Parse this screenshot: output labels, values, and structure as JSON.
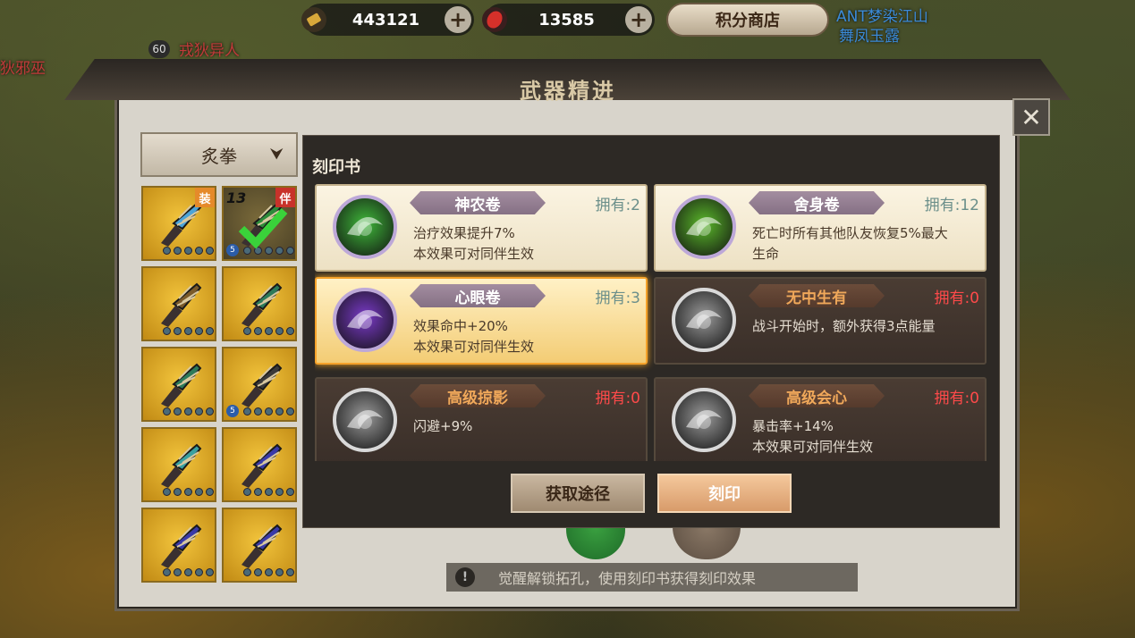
{
  "world": {
    "names_left": [
      "戎狄异人",
      "狄邪巫"
    ],
    "level": "60",
    "names_right": [
      "ANT梦染江山",
      "舞凤玉露"
    ]
  },
  "resources": {
    "gold": {
      "icon": "gold-ingot-icon",
      "value": "443121"
    },
    "gem": {
      "icon": "red-gem-icon",
      "value": "13585"
    },
    "shop_label": "积分商店"
  },
  "window": {
    "title": "武器精进",
    "close_icon": "close-icon"
  },
  "category": {
    "selected": "炙拳"
  },
  "weapon_slots": [
    {
      "tag": "装",
      "tag_color": "#e58a2a",
      "gem": "#4ba3d8"
    },
    {
      "tag": "伴",
      "tag_color": "#c8322a",
      "level": "13",
      "checked": true,
      "gem": "#2e8a3a",
      "num": "5"
    },
    {
      "gem": "#7a5a2a"
    },
    {
      "gem": "#2d7a5a"
    },
    {
      "gem": "#2d7a5a"
    },
    {
      "gem": "#3a3a3a",
      "num": "5"
    },
    {
      "gem": "#3aa0a0"
    },
    {
      "gem": "#3a3aa8"
    },
    {
      "gem": "#3a3aa8"
    },
    {
      "gem": "#3a3aa8"
    }
  ],
  "tabs": [
    "",
    "",
    "",
    "",
    "",
    "",
    ""
  ],
  "dialog": {
    "title": "刻印书",
    "books": [
      {
        "name": "神农卷",
        "owned": "拥有:2",
        "desc": [
          "治疗效果提升7%",
          "本效果可对同伴生效"
        ],
        "state": "owned",
        "icon": "green-swirl-icon",
        "color": "#3fb83a"
      },
      {
        "name": "舍身卷",
        "owned": "拥有:12",
        "desc": [
          "死亡时所有其他队友恢复5%最大",
          "生命"
        ],
        "state": "owned",
        "icon": "green-feather-icon",
        "color": "#5ab82a"
      },
      {
        "name": "心眼卷",
        "owned": "拥有:3",
        "desc": [
          "效果命中+20%",
          "本效果可对同伴生效"
        ],
        "state": "selected",
        "icon": "purple-eye-icon",
        "color": "#7a3ac8"
      },
      {
        "name": "无中生有",
        "owned": "拥有:0",
        "desc": [
          "战斗开始时，额外获得3点能量"
        ],
        "state": "unowned",
        "icon": "energy-orb-icon",
        "color": "#9a9a9a"
      },
      {
        "name": "高级掠影",
        "owned": "拥有:0",
        "desc": [
          "闪避+9%"
        ],
        "state": "unowned",
        "icon": "swirl-wind-icon",
        "color": "#9a9a9a"
      },
      {
        "name": "高级会心",
        "owned": "拥有:0",
        "desc": [
          "暴击率+14%",
          "本效果可对同伴生效"
        ],
        "state": "unowned",
        "icon": "eagle-head-icon",
        "color": "#9a9a9a"
      }
    ],
    "get_button": "获取途径",
    "engrave_button": "刻印"
  },
  "tip": "觉醒解锁拓孔，使用刻印书获得刻印效果"
}
